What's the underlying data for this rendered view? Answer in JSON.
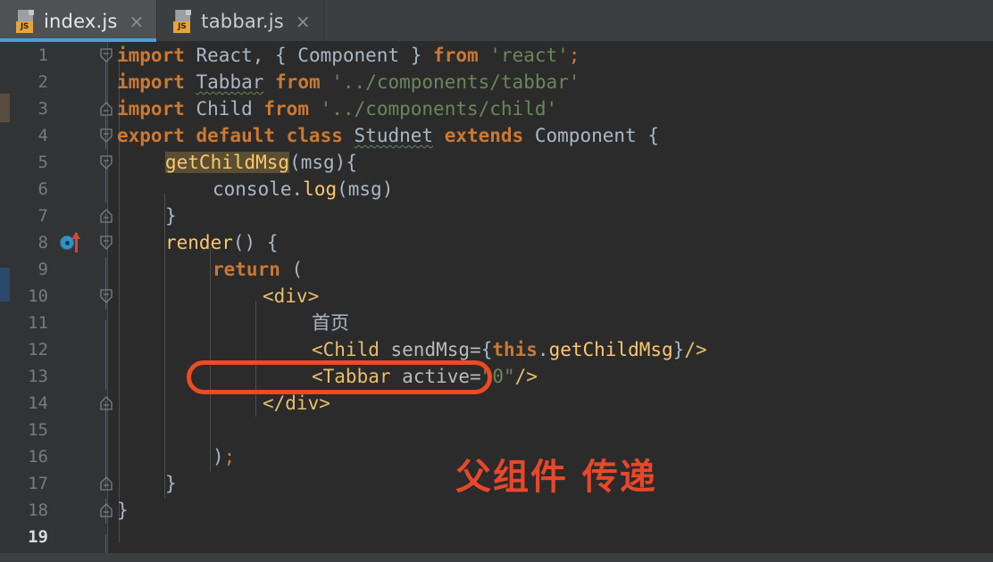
{
  "window": {
    "app": "IntelliJ IDEA / WebStorm code editor",
    "theme_background": "#2b2b2b"
  },
  "tabs": [
    {
      "label": "index.js",
      "icon": "js-file-icon",
      "badge": "JS",
      "active": true,
      "close": "×"
    },
    {
      "label": "tabbar.js",
      "icon": "js-file-icon",
      "badge": "JS",
      "active": false,
      "close": "×"
    }
  ],
  "editor": {
    "current_line": 19,
    "line_numbers": [
      "1",
      "2",
      "3",
      "4",
      "5",
      "6",
      "7",
      "8",
      "9",
      "10",
      "11",
      "12",
      "13",
      "14",
      "15",
      "16",
      "17",
      "18",
      "19"
    ],
    "lines": [
      {
        "n": 1,
        "indent": 0,
        "text": "import React, { Component } from 'react';"
      },
      {
        "n": 2,
        "indent": 0,
        "text": "import Tabbar from '../components/tabbar'"
      },
      {
        "n": 3,
        "indent": 0,
        "text": "import Child from '../components/child'"
      },
      {
        "n": 4,
        "indent": 0,
        "text": "export default class Studnet extends Component {"
      },
      {
        "n": 5,
        "indent": 1,
        "text": "getChildMsg(msg){"
      },
      {
        "n": 6,
        "indent": 2,
        "text": "console.log(msg)"
      },
      {
        "n": 7,
        "indent": 1,
        "text": "}"
      },
      {
        "n": 8,
        "indent": 1,
        "text": "render() {"
      },
      {
        "n": 9,
        "indent": 2,
        "text": "return ("
      },
      {
        "n": 10,
        "indent": 3,
        "text": "<div>"
      },
      {
        "n": 11,
        "indent": 4,
        "text": "首页"
      },
      {
        "n": 12,
        "indent": 4,
        "text": "<Child sendMsg={this.getChildMsg}/>"
      },
      {
        "n": 13,
        "indent": 4,
        "text": "<Tabbar active=\"0\"/>"
      },
      {
        "n": 14,
        "indent": 3,
        "text": "</div>"
      },
      {
        "n": 15,
        "indent": 0,
        "text": ""
      },
      {
        "n": 16,
        "indent": 2,
        "text": ");"
      },
      {
        "n": 17,
        "indent": 1,
        "text": "}"
      },
      {
        "n": 18,
        "indent": 0,
        "text": "}"
      },
      {
        "n": 19,
        "indent": 0,
        "text": ""
      }
    ],
    "gutter_icon": {
      "line": 8,
      "name": "override-method-marker",
      "description": "cyan disc with red up arrow (overriding method)"
    }
  },
  "annotations": {
    "highlight_box": {
      "target_line": 13,
      "target_text": "<Tabbar active=\"0\"/>",
      "color": "#ef4a22"
    },
    "caption": {
      "text": "父组件 传递",
      "color": "#e8472a"
    }
  },
  "colors": {
    "background": "#2b2b2b",
    "gutter": "#313335",
    "tabbar": "#3c3f41",
    "active_tab": "#4e5254",
    "active_tab_underline": "#4a9fd4",
    "keyword": "#cc7832",
    "string": "#6a8759",
    "function": "#ffc66d",
    "tag": "#e8bf6a",
    "identifier": "#a9b7c6",
    "annotation_red": "#ef4a22"
  }
}
